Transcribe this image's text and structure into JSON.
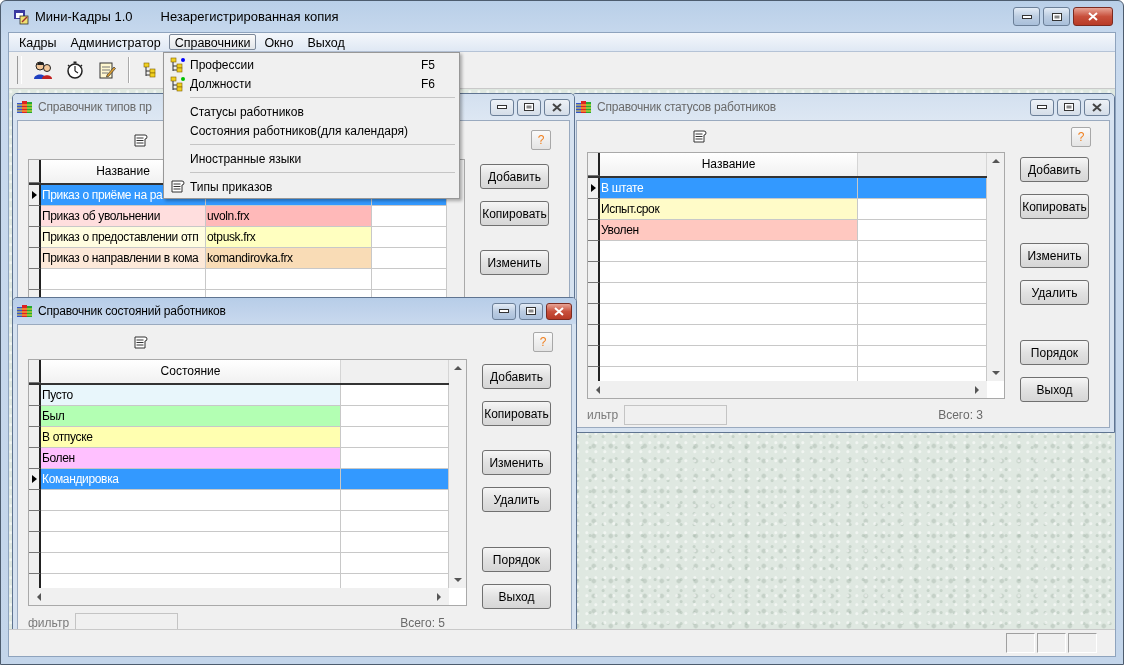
{
  "window": {
    "title": "Мини-Кадры 1.0",
    "subtitle": "Незарегистрированная копия"
  },
  "menu": [
    {
      "label": "Кадры",
      "selected": false
    },
    {
      "label": "Администратор",
      "selected": false
    },
    {
      "label": "Справочники",
      "selected": true
    },
    {
      "label": "Окно",
      "selected": false
    },
    {
      "label": "Выход",
      "selected": false
    }
  ],
  "dropdown": [
    {
      "kind": "tree-item",
      "label": "Профессии",
      "shortcut": "F5",
      "color": "#0000ff"
    },
    {
      "kind": "tree-item",
      "label": "Должности",
      "shortcut": "F6",
      "color": "#00c000"
    },
    {
      "kind": "separator"
    },
    {
      "kind": "item",
      "label": "Статусы работников"
    },
    {
      "kind": "item",
      "label": "Состояния работников(для календаря)"
    },
    {
      "kind": "separator"
    },
    {
      "kind": "item",
      "label": "Иностранные языки"
    },
    {
      "kind": "separator"
    },
    {
      "kind": "scroll-item",
      "label": "Типы приказов"
    }
  ],
  "child_windows": [
    {
      "title": "Справочник типов пр",
      "active": false,
      "help": "?",
      "columns": [
        {
          "label": "Название"
        },
        {},
        {}
      ],
      "rows": [
        {
          "selected": true,
          "cells": [
            {
              "text": "Приказ о приёме на ра"
            }
          ]
        },
        {
          "selected": false,
          "cells": [
            {
              "text": "Приказ об увольнении",
              "color": "#ffdede"
            },
            {
              "text": "uvoln.frx",
              "color": "#ffb9b9"
            }
          ]
        },
        {
          "selected": false,
          "cells": [
            {
              "text": "Приказ о предоставлении отп",
              "color": "#fffde0"
            },
            {
              "text": "otpusk.frx",
              "color": "#ffffc0"
            }
          ]
        },
        {
          "selected": false,
          "cells": [
            {
              "text": "Приказ о направлении в кома",
              "color": "#fde9d9"
            },
            {
              "text": "komandirovka.frx",
              "color": "#f9dcb6"
            }
          ]
        }
      ],
      "button_groups": [
        [
          "Добавить",
          "Копировать"
        ],
        [
          "Изменить"
        ]
      ]
    },
    {
      "title": "Справочник статусов работников",
      "active": false,
      "help": "?",
      "columns": [
        {
          "label": "Название"
        },
        {}
      ],
      "rows": [
        {
          "selected": true,
          "cells": [
            {
              "text": "В штате"
            }
          ]
        },
        {
          "selected": false,
          "cells": [
            {
              "text": "Испыт.срок",
              "color": "#fffbc8"
            }
          ]
        },
        {
          "selected": false,
          "cells": [
            {
              "text": "Уволен",
              "color": "#ffc8c0"
            }
          ]
        }
      ],
      "button_groups": [
        [
          "Добавить",
          "Копировать"
        ],
        [
          "Изменить",
          "Удалить"
        ],
        [
          "Порядок",
          "Выход"
        ]
      ],
      "filter_label": "ильтр",
      "total": "Всего: 3"
    },
    {
      "title": "Справочник состояний работников",
      "active": true,
      "help": "?",
      "columns": [
        {
          "label": "Состояние"
        },
        {}
      ],
      "rows": [
        {
          "selected": false,
          "cells": [
            {
              "text": "Пусто",
              "color": "#e8f6fb"
            }
          ]
        },
        {
          "selected": false,
          "cells": [
            {
              "text": "Был",
              "color": "#b3ffb3"
            }
          ]
        },
        {
          "selected": false,
          "cells": [
            {
              "text": "В отпуске",
              "color": "#ffffb0"
            }
          ]
        },
        {
          "selected": false,
          "cells": [
            {
              "text": "Болен",
              "color": "#ffc0ff"
            }
          ]
        },
        {
          "selected": true,
          "cells": [
            {
              "text": "Командировка"
            }
          ]
        }
      ],
      "button_groups": [
        [
          "Добавить",
          "Копировать"
        ],
        [
          "Изменить",
          "Удалить"
        ],
        [
          "Порядок",
          "Выход"
        ]
      ],
      "filter_label": "фильтр",
      "total": "Всего: 5"
    }
  ]
}
